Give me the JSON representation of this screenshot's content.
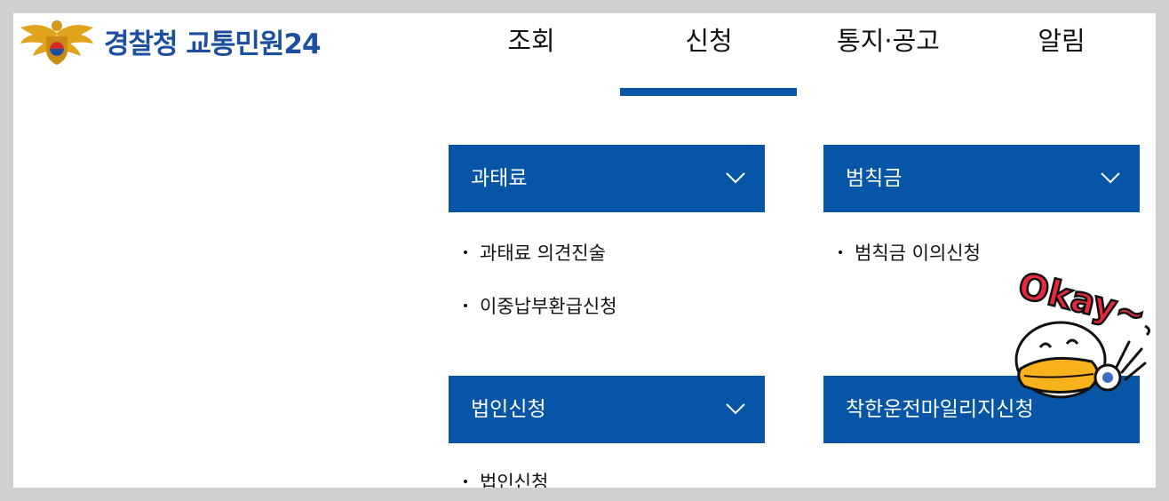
{
  "header": {
    "logo_text": "경찰청 교통민원24"
  },
  "nav": {
    "items": [
      {
        "label": "조회"
      },
      {
        "label": "신청"
      },
      {
        "label": "통지·공고"
      },
      {
        "label": "알림"
      }
    ],
    "active_index": 1
  },
  "menu": {
    "sections": [
      {
        "title": "과태료",
        "items": [
          "과태료 의견진술",
          "이중납부환급신청"
        ]
      },
      {
        "title": "범칙금",
        "items": [
          "범칙금 이의신청"
        ]
      },
      {
        "title": "법인신청",
        "items": [
          "법인신청"
        ]
      },
      {
        "title": "착한운전마일리지신청",
        "items": []
      }
    ]
  },
  "sticker": {
    "text": "Okay~"
  },
  "colors": {
    "accent": "#0755a6",
    "logo_text": "#1c4fa0",
    "nav_underline": "#0a56a7"
  }
}
